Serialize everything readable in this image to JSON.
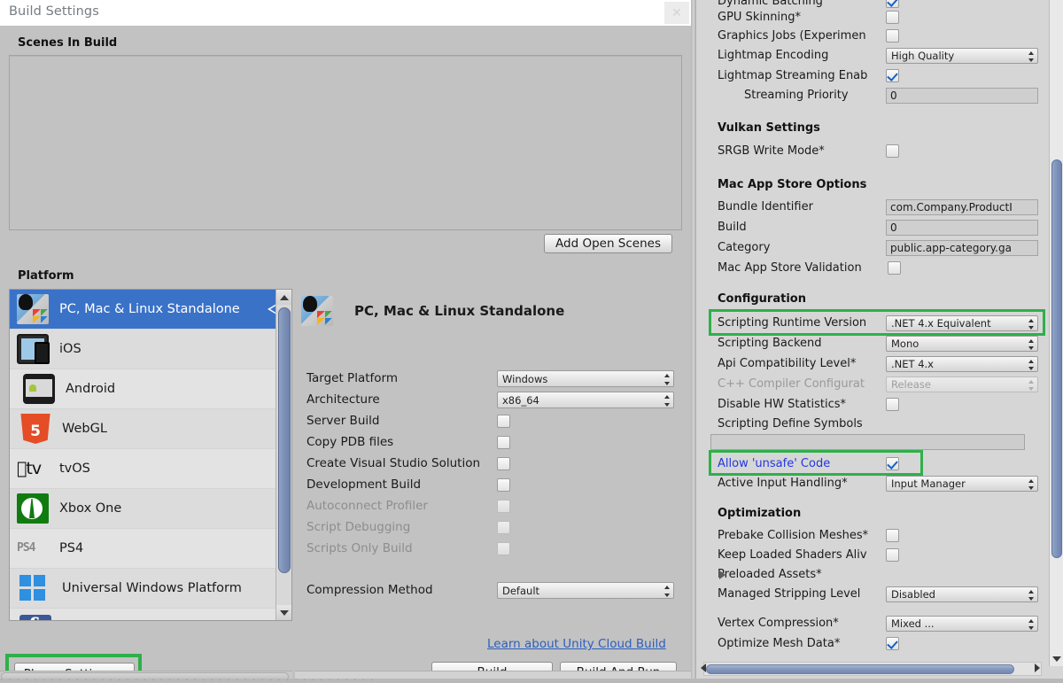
{
  "window": {
    "title": "Build Settings",
    "close_icon": "close-icon"
  },
  "scenes": {
    "section_title": "Scenes In Build",
    "add_open_scenes_label": "Add Open Scenes"
  },
  "platform": {
    "section_title": "Platform",
    "items": [
      {
        "label": "PC, Mac & Linux Standalone",
        "icon": "standalone-icon",
        "selected": true
      },
      {
        "label": "iOS",
        "icon": "ios-icon",
        "selected": false
      },
      {
        "label": "Android",
        "icon": "android-icon",
        "selected": false
      },
      {
        "label": "WebGL",
        "icon": "webgl-icon",
        "selected": false
      },
      {
        "label": "tvOS",
        "icon": "tvos-icon",
        "selected": false
      },
      {
        "label": "Xbox One",
        "icon": "xbox-icon",
        "selected": false
      },
      {
        "label": "PS4",
        "icon": "ps4-icon",
        "selected": false
      },
      {
        "label": "Universal Windows Platform",
        "icon": "uwp-icon",
        "selected": false
      },
      {
        "label": "",
        "icon": "facebook-icon",
        "selected": false
      }
    ]
  },
  "detail": {
    "heading": "PC, Mac & Linux Standalone",
    "rows": [
      {
        "label": "Target Platform",
        "type": "popup",
        "value": "Windows",
        "dim": false
      },
      {
        "label": "Architecture",
        "type": "popup",
        "value": "x86_64",
        "dim": false
      },
      {
        "label": "Server Build",
        "type": "check",
        "value": false,
        "dim": false
      },
      {
        "label": "Copy PDB files",
        "type": "check",
        "value": false,
        "dim": false
      },
      {
        "label": "Create Visual Studio Solution",
        "type": "check",
        "value": false,
        "dim": false
      },
      {
        "label": "Development Build",
        "type": "check",
        "value": false,
        "dim": false
      },
      {
        "label": "Autoconnect Profiler",
        "type": "check",
        "value": false,
        "dim": true
      },
      {
        "label": "Script Debugging",
        "type": "check",
        "value": false,
        "dim": true
      },
      {
        "label": "Scripts Only Build",
        "type": "check",
        "value": false,
        "dim": true
      }
    ],
    "compression_label": "Compression Method",
    "compression_value": "Default"
  },
  "footer": {
    "cloud_build_link": "Learn about Unity Cloud Build",
    "player_settings_label": "Player Settings...",
    "build_label": "Build",
    "build_and_run_label": "Build And Run"
  },
  "inspector": {
    "groups": [
      {
        "title": null,
        "rows": [
          {
            "label": "Dynamic Batching",
            "type": "check",
            "value": true,
            "dim": false,
            "clipped": true
          },
          {
            "label": "GPU Skinning*",
            "type": "check",
            "value": false,
            "dim": false
          },
          {
            "label": "Graphics Jobs (Experimen",
            "type": "check",
            "value": false,
            "dim": false
          },
          {
            "label": "Lightmap Encoding",
            "type": "popup",
            "value": "High Quality",
            "dim": false
          },
          {
            "label": "Lightmap Streaming Enab",
            "type": "check",
            "value": true,
            "dim": false
          },
          {
            "label": "Streaming Priority",
            "type": "text",
            "value": "0",
            "dim": false,
            "indent": true
          }
        ]
      },
      {
        "title": "Vulkan Settings",
        "rows": [
          {
            "label": "SRGB Write Mode*",
            "type": "check",
            "value": false,
            "dim": false
          }
        ]
      },
      {
        "title": "Mac App Store Options",
        "rows": [
          {
            "label": "Bundle Identifier",
            "type": "text",
            "value": "com.Company.ProductI",
            "dim": false
          },
          {
            "label": "Build",
            "type": "text",
            "value": "0",
            "dim": false
          },
          {
            "label": "Category",
            "type": "text",
            "value": "public.app-category.ga",
            "dim": false
          },
          {
            "label": "Mac App Store Validation",
            "type": "check",
            "value": false,
            "dim": false
          }
        ]
      },
      {
        "title": "Configuration",
        "rows": [
          {
            "label": "Scripting Runtime Version",
            "type": "popup",
            "value": ".NET 4.x Equivalent",
            "dim": false,
            "highlighted": true
          },
          {
            "label": "Scripting Backend",
            "type": "popup",
            "value": "Mono",
            "dim": false
          },
          {
            "label": "Api Compatibility Level*",
            "type": "popup",
            "value": ".NET 4.x",
            "dim": false
          },
          {
            "label": "C++ Compiler Configurat",
            "type": "popup",
            "value": "Release",
            "dim": true
          },
          {
            "label": "Disable HW Statistics*",
            "type": "check",
            "value": false,
            "dim": false
          },
          {
            "label": "Scripting Define Symbols",
            "type": "none",
            "value": "",
            "dim": false
          },
          {
            "label": "",
            "type": "textwide",
            "value": "",
            "dim": false
          },
          {
            "label": "Allow 'unsafe' Code",
            "type": "check",
            "value": true,
            "dim": false,
            "link": true,
            "highlighted": true
          },
          {
            "label": "Active Input Handling*",
            "type": "popup",
            "value": "Input Manager",
            "dim": false
          }
        ]
      },
      {
        "title": "Optimization",
        "rows": [
          {
            "label": "Prebake Collision Meshes*",
            "type": "check",
            "value": false,
            "dim": false
          },
          {
            "label": "Keep Loaded Shaders Aliv",
            "type": "check",
            "value": false,
            "dim": false
          },
          {
            "label": "Preloaded Assets*",
            "type": "foldout",
            "value": "",
            "dim": false
          },
          {
            "label": "Managed Stripping Level",
            "type": "popup",
            "value": "Disabled",
            "dim": false
          },
          {
            "label": "Vertex Compression*",
            "type": "popup",
            "value": "Mixed ...",
            "dim": false,
            "gap": true
          },
          {
            "label": "Optimize Mesh Data*",
            "type": "check",
            "value": true,
            "dim": false
          }
        ]
      }
    ]
  },
  "colors": {
    "highlight_green": "#2eb04a",
    "selection_blue": "#3a72c8",
    "link_blue": "#2b5fbd",
    "unsafe_label_blue": "#2337e0",
    "panel_grey": "#c2c2c2",
    "inspector_grey": "#d6d6d6"
  }
}
